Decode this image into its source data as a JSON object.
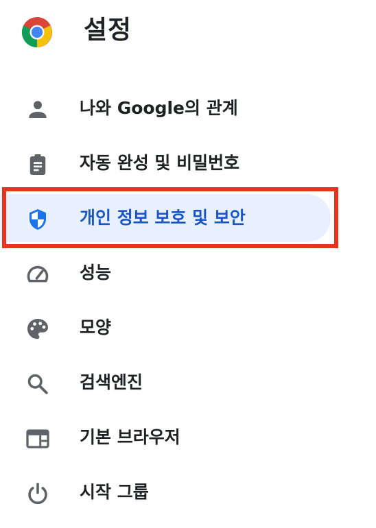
{
  "header": {
    "title": "설정",
    "logo_icon": "chrome-logo-icon"
  },
  "colors": {
    "text": "#202124",
    "icon": "#5f6368",
    "active_text": "#1a56c4",
    "active_icon": "#1a73e8",
    "active_bg": "#e8f0fe",
    "highlight_border": "#e8341c"
  },
  "sidebar": {
    "items": [
      {
        "label": "나와 Google의 관계",
        "icon": "person-icon",
        "active": false
      },
      {
        "label": "자동 완성 및 비밀번호",
        "icon": "clipboard-icon",
        "active": false
      },
      {
        "label": "개인 정보 보호 및 보안",
        "icon": "shield-icon",
        "active": true
      },
      {
        "label": "성능",
        "icon": "speedometer-icon",
        "active": false
      },
      {
        "label": "모양",
        "icon": "palette-icon",
        "active": false
      },
      {
        "label": "검색엔진",
        "icon": "search-icon",
        "active": false
      },
      {
        "label": "기본 브라우저",
        "icon": "browser-window-icon",
        "active": false
      },
      {
        "label": "시작 그룹",
        "icon": "power-icon",
        "active": false
      }
    ]
  }
}
